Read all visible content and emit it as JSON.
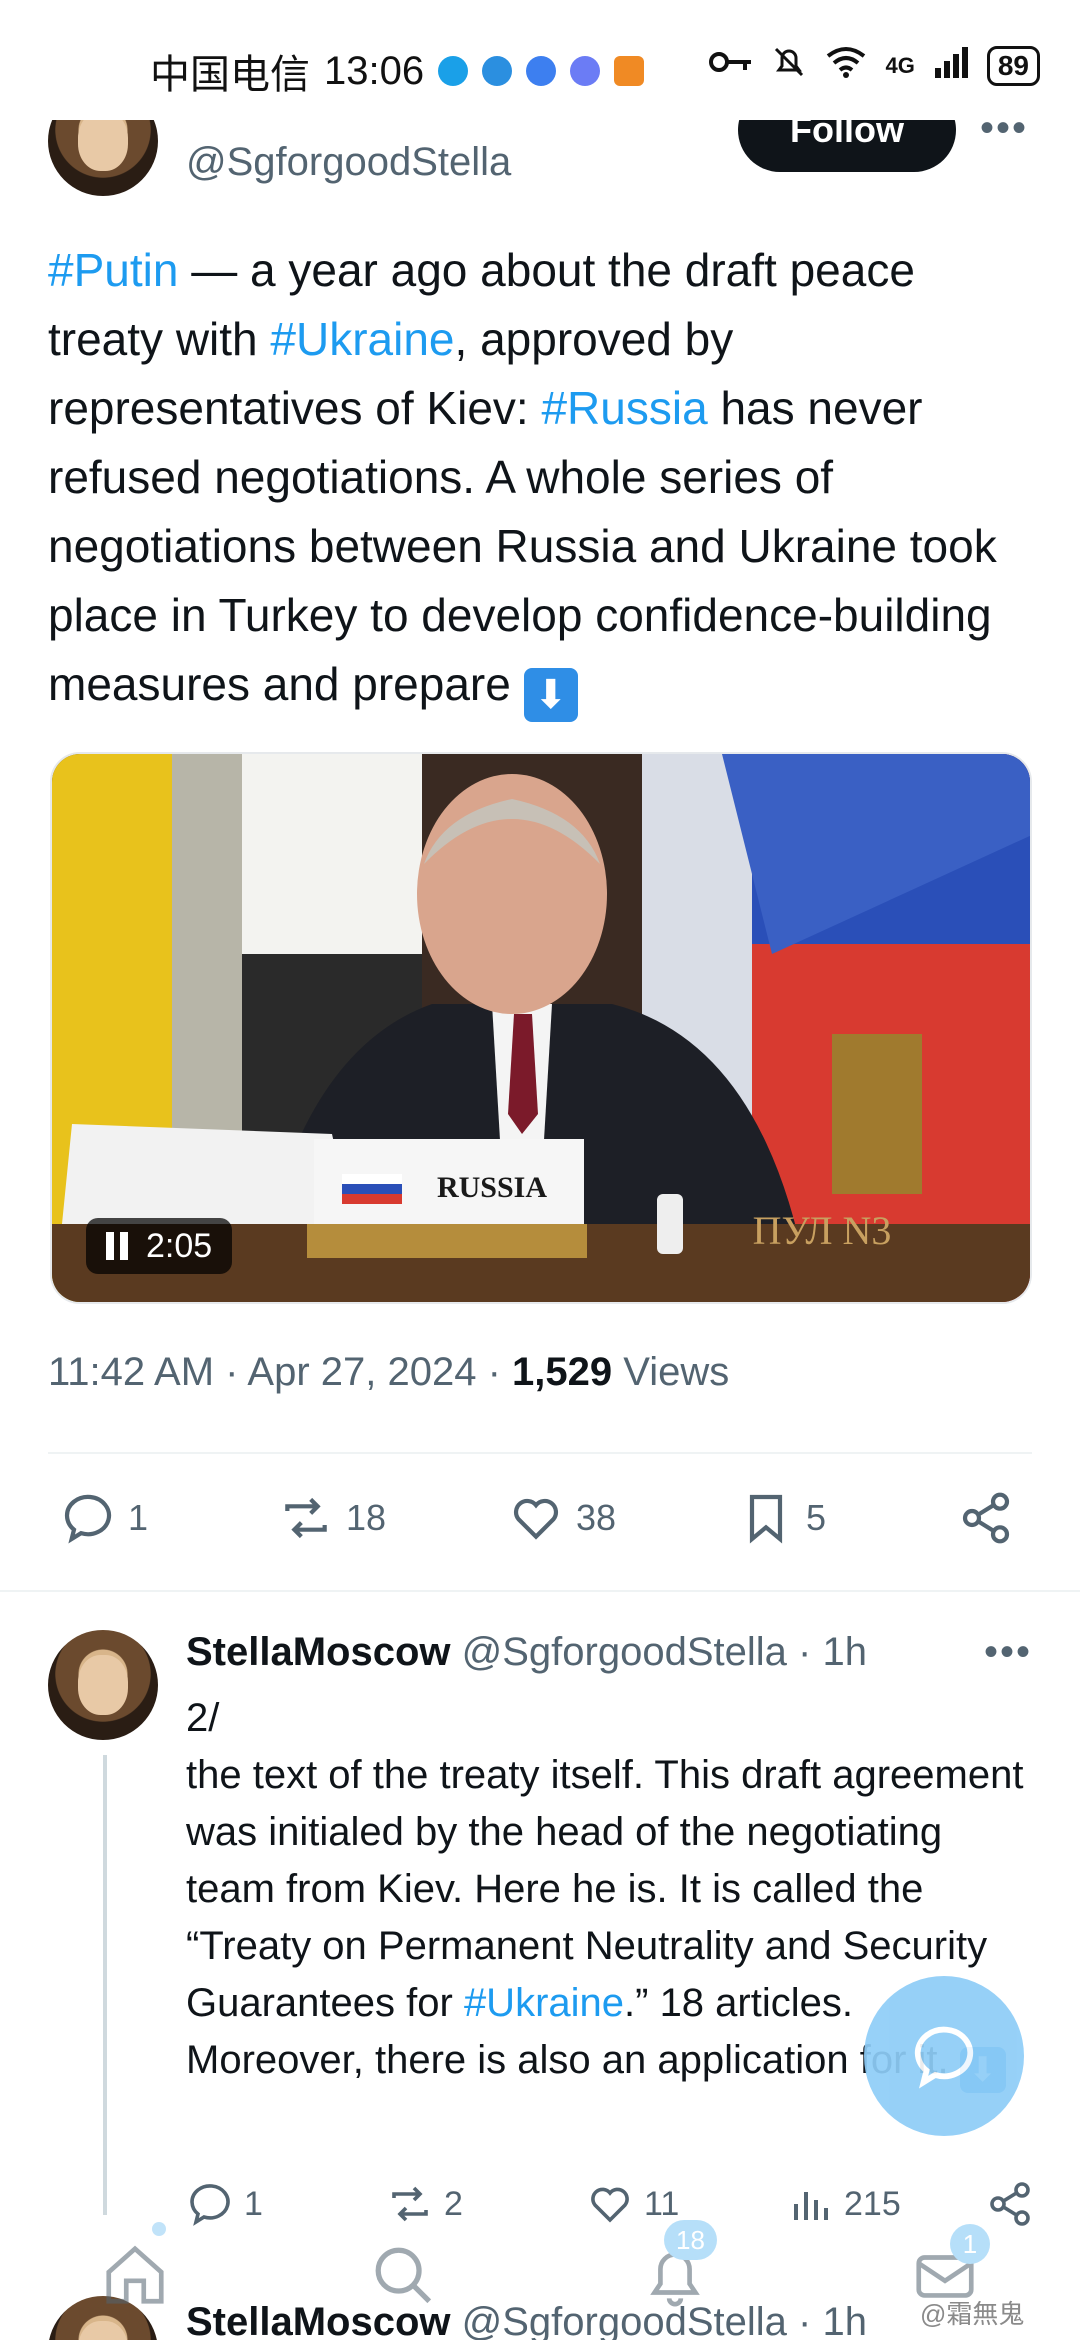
{
  "status_bar": {
    "carrier": "中国电信",
    "time": "13:06",
    "network": "4G",
    "battery": "89"
  },
  "tweet": {
    "handle": "@SgforgoodStella",
    "follow_label": "Follow",
    "more": "•••",
    "text_parts": {
      "t1": "#Putin",
      "t2": " — a year ago about the draft peace treaty with ",
      "t3": "#Ukraine",
      "t4": ", approved by representatives of Kiev: ",
      "t5": "#Russia",
      "t6": " has never refused negotiations. A whole series of negotiations between Russia and Ukraine took place in Turkey to develop confidence-building measures and prepare "
    },
    "video": {
      "duration": "2:05",
      "nameplate": "RUSSIA",
      "overlay": "ПУЛ N3"
    },
    "time": "11:42 AM",
    "date": "Apr 27, 2024",
    "views_count": "1,529",
    "views_label": "Views",
    "actions": {
      "replies": "1",
      "reposts": "18",
      "likes": "38",
      "bookmarks": "5"
    }
  },
  "reply": {
    "name": "StellaMoscow",
    "handle": "@SgforgoodStella",
    "age": "· 1h",
    "more": "•••",
    "text_parts": {
      "r1": "2/",
      "r2": "the text of the treaty itself. This draft agreement was initialed by the head of the negotiating team from Kiev. Here he is. It is called the “Treaty on Permanent Neutrality and Security Guarantees for ",
      "r3": "#Ukraine",
      "r4": ".” 18 articles. Moreover, there is also an application for it. "
    },
    "actions": {
      "replies": "1",
      "reposts": "2",
      "likes": "11",
      "views": "215"
    }
  },
  "next_tweet": {
    "name": "StellaMoscow",
    "handle": "@SgforgoodStella",
    "age": "· 1h"
  },
  "bottom_nav": {
    "notifications_badge": "18",
    "messages_badge": "1"
  },
  "watermark": "@霜無鬼",
  "colors": {
    "link": "#1d9bf0",
    "text": "#0f1419",
    "muted": "#536471",
    "fab": "#8ecdf7"
  }
}
